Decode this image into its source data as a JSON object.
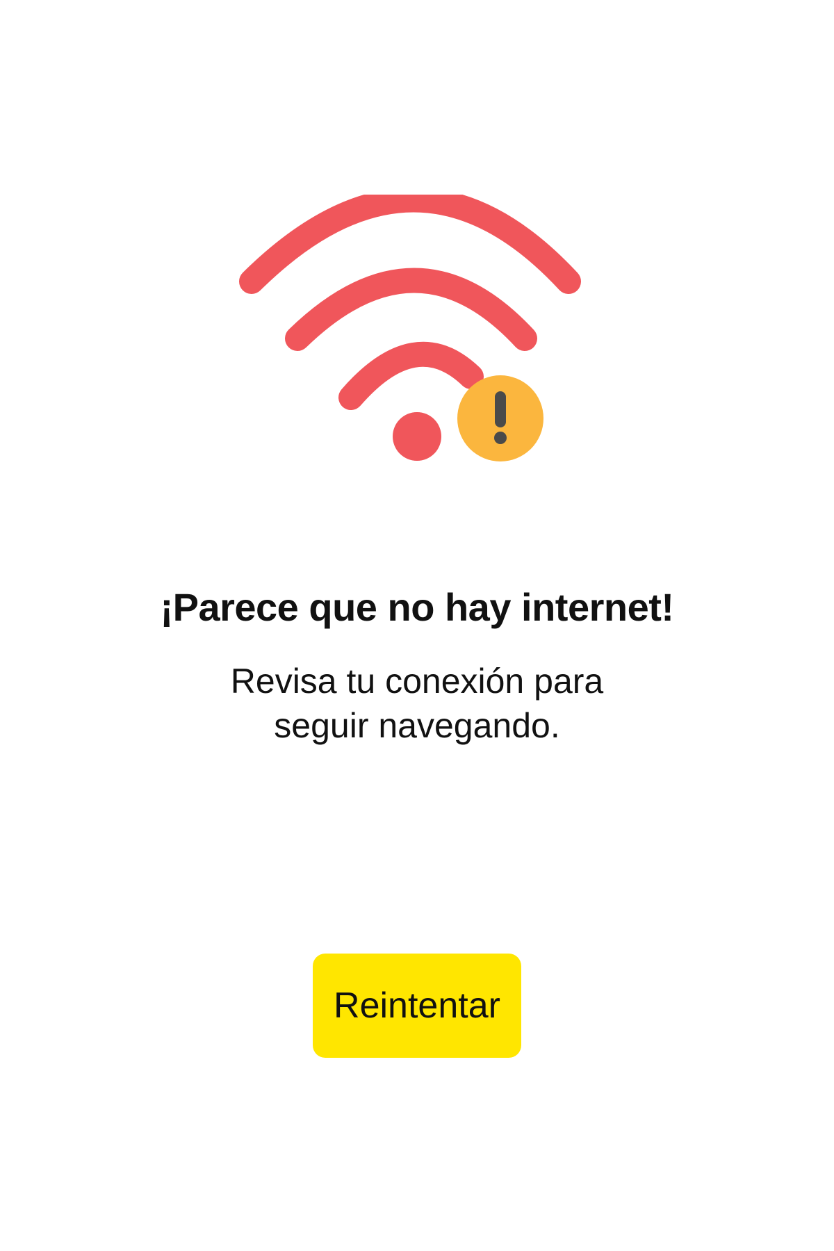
{
  "illustration": {
    "icon": "wifi-off-warning-icon",
    "wifi_color": "#F0565B",
    "warning_badge_color": "#FBB63E",
    "warning_mark_color": "#4A4A4A"
  },
  "error": {
    "title": "¡Parece que no hay internet!",
    "message_line_1": "Revisa tu conexión para",
    "message_line_2": "seguir navegando."
  },
  "actions": {
    "retry_label": "Reintentar",
    "retry_color": "#FFE600"
  }
}
